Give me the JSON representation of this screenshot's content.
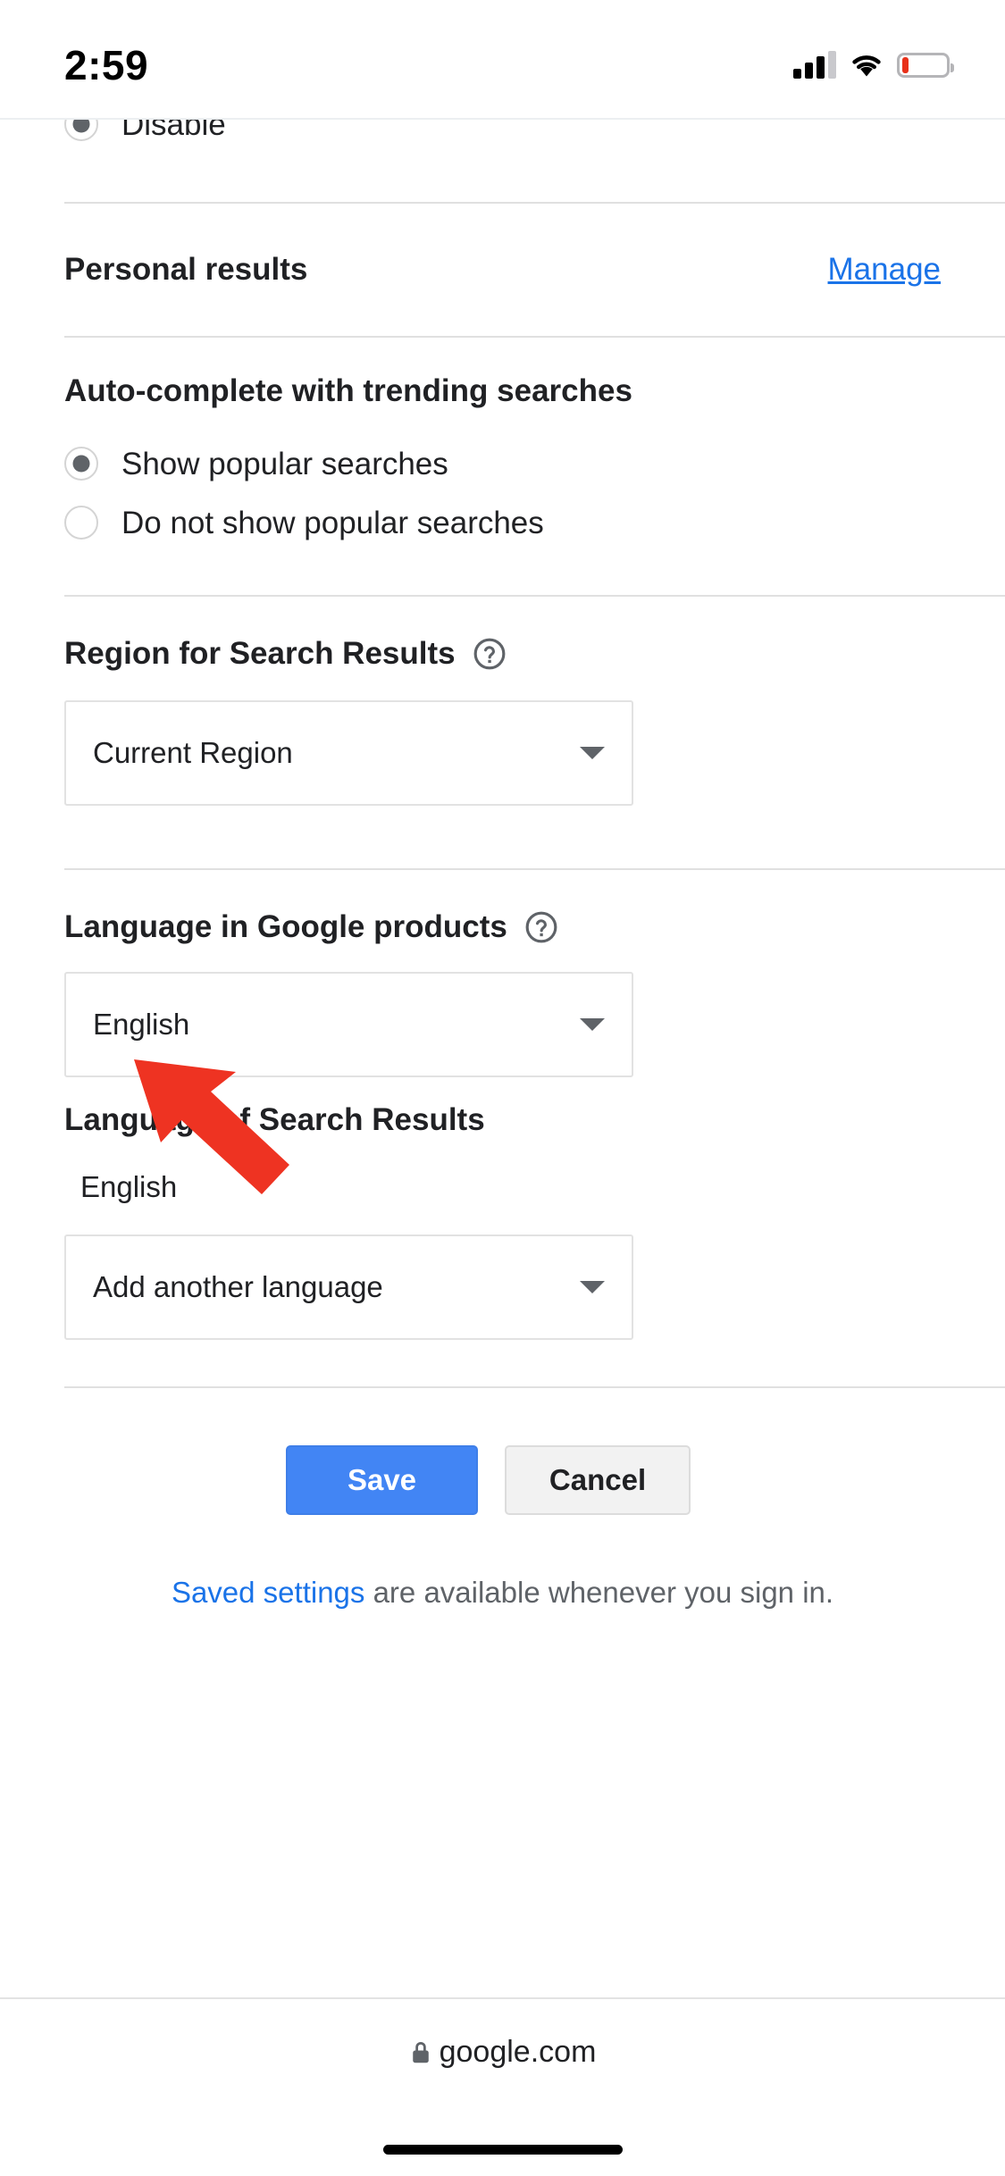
{
  "status_bar": {
    "time": "2:59",
    "icons": [
      "cellular-signal-icon",
      "wifi-icon",
      "battery-low-icon"
    ],
    "battery_color": "#e8311a"
  },
  "page": {
    "clipped_row": {
      "label": "Disable",
      "selected": true
    },
    "personal_results": {
      "title": "Personal results",
      "manage_link": "Manage"
    },
    "autocomplete": {
      "title": "Auto-complete with trending searches",
      "options": [
        {
          "label": "Show popular searches",
          "selected": true
        },
        {
          "label": "Do not show popular searches",
          "selected": false
        }
      ]
    },
    "region": {
      "title": "Region for Search Results",
      "help_icon": "help-circle-icon",
      "select_value": "Current Region"
    },
    "language_products": {
      "title": "Language in Google products",
      "help_icon": "help-circle-icon",
      "select_value": "English"
    },
    "language_results": {
      "title": "Language of Search Results",
      "current_value": "English",
      "select_value": "Add another language"
    },
    "actions": {
      "save_label": "Save",
      "cancel_label": "Cancel",
      "save_color": "#4285f4",
      "cancel_color": "#f2f2f2"
    },
    "footer_note": {
      "link_text": "Saved settings",
      "rest_text": " are available whenever you sign in."
    }
  },
  "annotation": {
    "type": "arrow",
    "color": "#ee3322",
    "points_to": "save-button"
  },
  "browser_bar": {
    "url": "google.com",
    "lock_icon": "lock-icon"
  }
}
